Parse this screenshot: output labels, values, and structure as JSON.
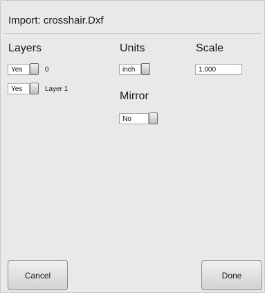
{
  "dialog": {
    "title": "Import: crosshair.Dxf"
  },
  "layers": {
    "heading": "Layers",
    "items": [
      {
        "visible": "Yes",
        "name": "0"
      },
      {
        "visible": "Yes",
        "name": "Layer 1"
      }
    ]
  },
  "units": {
    "heading": "Units",
    "value": "inch"
  },
  "mirror": {
    "heading": "Mirror",
    "value": "No"
  },
  "scale": {
    "heading": "Scale",
    "value": "1.000"
  },
  "buttons": {
    "cancel": "Cancel",
    "done": "Done"
  }
}
